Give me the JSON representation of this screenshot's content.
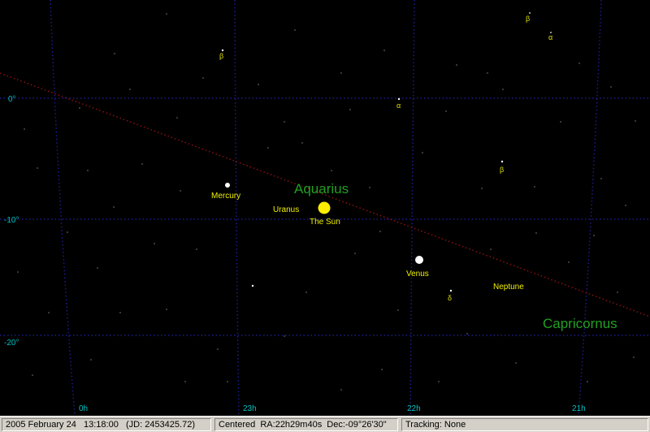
{
  "colors": {
    "background": "#000000",
    "grid": "#1c1c8c",
    "ecliptic": "#8c1010",
    "coord_label": "#00c0c0",
    "constellation_label": "#22a022",
    "planet_label": "#f0f000",
    "star_label": "#e0e000"
  },
  "grid": {
    "ra_labels": [
      "0h",
      "23h",
      "22h",
      "21h"
    ],
    "dec_labels": [
      "0°",
      "-10°",
      "-20°"
    ]
  },
  "constellations": [
    "Aquarius",
    "Capricornus"
  ],
  "bodies": {
    "sun": "The Sun",
    "mercury": "Mercury",
    "venus": "Venus",
    "uranus": "Uranus",
    "neptune": "Neptune"
  },
  "star_labels": [
    "β",
    "β",
    "α",
    "α",
    "β",
    "δ"
  ],
  "status": {
    "datetime": "2005 February 24   13:18:00   (JD: 2453425.72)",
    "centered": "Centered  RA:22h29m40s  Dec:-09°26'30\"",
    "tracking": "Tracking: None"
  }
}
